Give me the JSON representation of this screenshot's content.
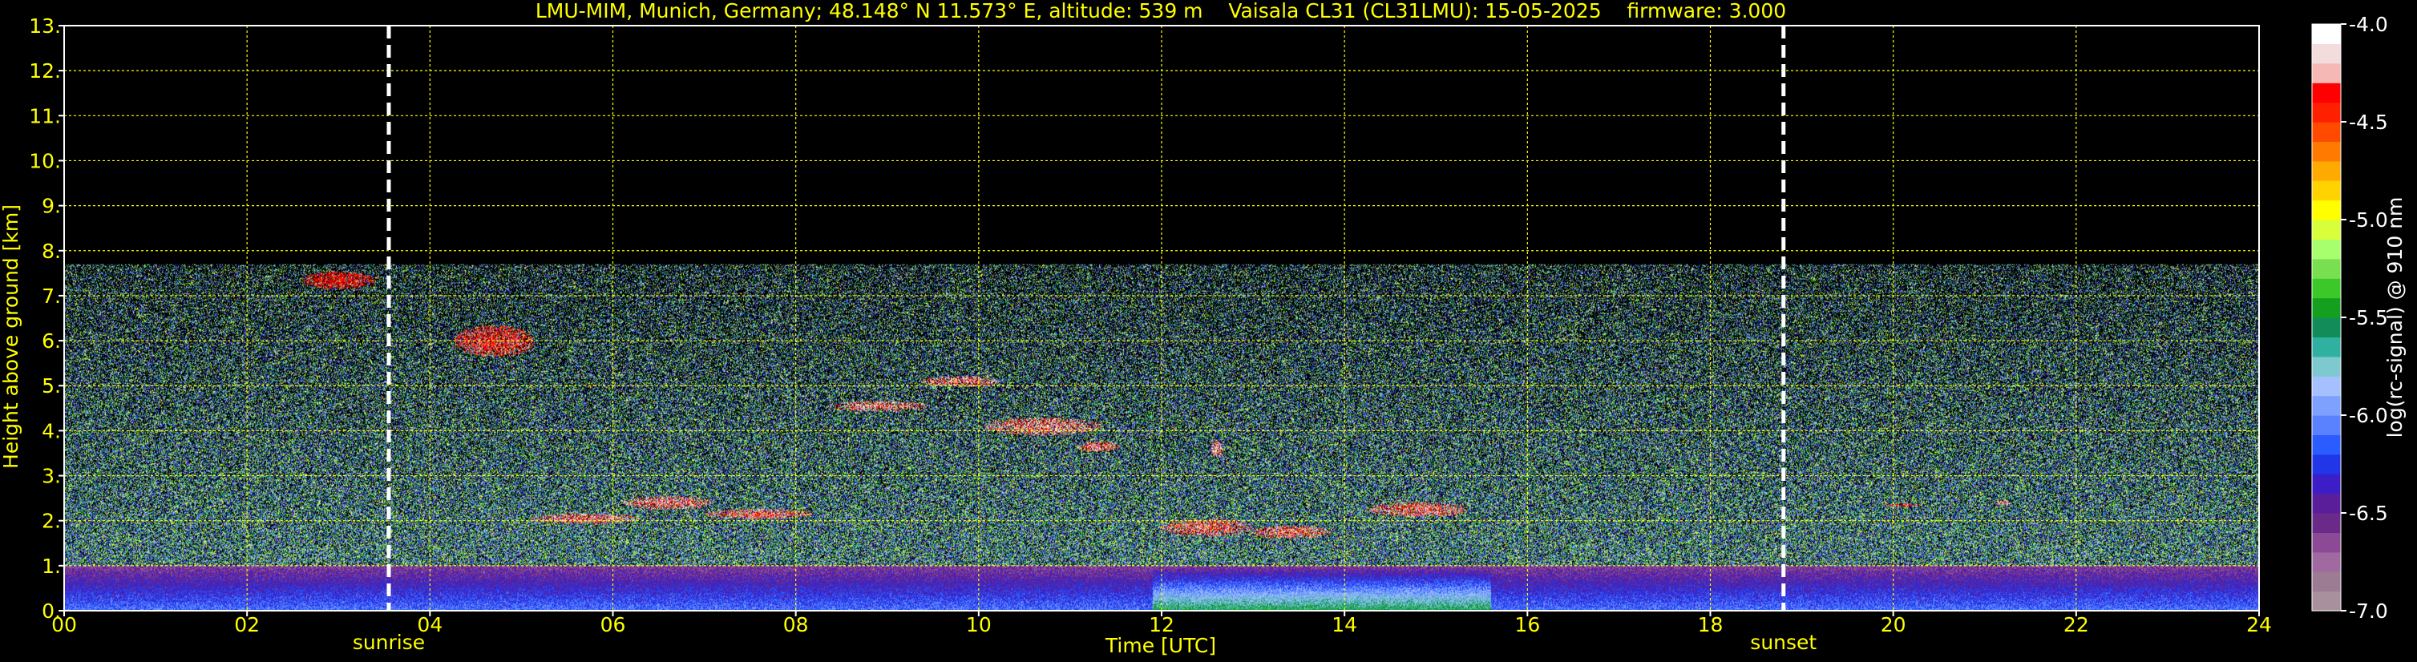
{
  "chart_data": {
    "type": "heatmap",
    "title": "LMU-MIM, Munich, Germany; 48.148° N 11.573° E, altitude: 539 m    Vaisala CL31 (CL31LMU): 15-05-2025    firmware: 3.000",
    "xlabel": "Time [UTC]",
    "ylabel": "Height above ground [km]",
    "xlim": [
      0,
      24
    ],
    "ylim": [
      0,
      13
    ],
    "x_ticks": [
      "00",
      "02",
      "04",
      "06",
      "08",
      "10",
      "12",
      "14",
      "16",
      "18",
      "20",
      "22",
      "24"
    ],
    "y_ticks": [
      "0.",
      "1.",
      "2.",
      "3.",
      "4.",
      "5.",
      "6.",
      "7.",
      "8.",
      "9.",
      "10.",
      "11.",
      "12.",
      "13."
    ],
    "grid": true,
    "grid_color": "#ffff00",
    "text_color": "#ffff00",
    "background": "#000000",
    "signal_top_km": 7.7,
    "markers": [
      {
        "label": "sunrise",
        "x": 3.55
      },
      {
        "label": "sunset",
        "x": 18.8
      }
    ],
    "colorbar": {
      "label": "log(rc-signal) @ 910 nm",
      "range": [
        -7.0,
        -4.0
      ],
      "ticks": [
        "-4.0",
        "-4.5",
        "-5.0",
        "-5.5",
        "-6.0",
        "-6.5",
        "-7.0"
      ],
      "colors": [
        "#a8909c",
        "#9c7c92",
        "#a06aa0",
        "#8c4a96",
        "#6a2a8a",
        "#5a1e9a",
        "#3c1ec8",
        "#2036e8",
        "#2a5cff",
        "#5a82ff",
        "#7ea0ff",
        "#a6c0ff",
        "#7ec8d0",
        "#30b0a0",
        "#128c58",
        "#14a01e",
        "#3cc828",
        "#78e050",
        "#a8ff6e",
        "#d8ff3a",
        "#ffff00",
        "#ffd200",
        "#ffaa00",
        "#ff7a00",
        "#ff4a00",
        "#ff2000",
        "#ff0000",
        "#f6b8b4",
        "#f2dcdc",
        "#ffffff"
      ]
    }
  }
}
